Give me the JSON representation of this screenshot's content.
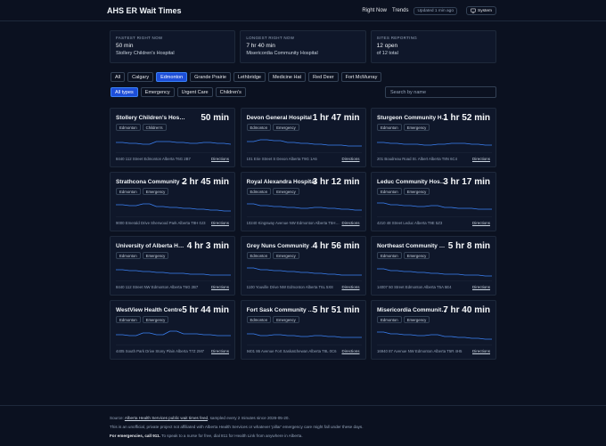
{
  "app": {
    "title": "AHS ER Wait Times"
  },
  "nav": {
    "right_now": "Right Now",
    "trends": "Trends",
    "updated": "Updated 1 min ago",
    "system": "System"
  },
  "stats": [
    {
      "label": "FASTEST RIGHT NOW",
      "value": "50 min",
      "sub": "Stollery Children's Hospital"
    },
    {
      "label": "LONGEST RIGHT NOW",
      "value": "7 hr 40 min",
      "sub": "Misericordia Community Hospital"
    },
    {
      "label": "SITES REPORTING",
      "value": "12 open",
      "sub": "of 12 total"
    }
  ],
  "cities": [
    "All",
    "Calgary",
    "Edmonton",
    "Grande Prairie",
    "Lethbridge",
    "Medicine Hat",
    "Red Deer",
    "Fort McMurray"
  ],
  "active_city": "Edmonton",
  "types": [
    "All types",
    "Emergency",
    "Urgent Care",
    "Children's"
  ],
  "active_type": "All types",
  "search": {
    "placeholder": "Search by name"
  },
  "directions_label": "Directions",
  "colors": {
    "accent": "#1d4ed8",
    "spark": "#3b82f6"
  },
  "hospitals": [
    {
      "name": "Stollery Children's Hospital",
      "wait": "50 min",
      "tags": [
        "Edmonton",
        "Children's"
      ],
      "address": "8440 112 Street Edmonton Alberta T6G 2B7",
      "trend": [
        0.55,
        0.55,
        0.5,
        0.5,
        0.45,
        0.45,
        0.6,
        0.6,
        0.6,
        0.55,
        0.55,
        0.5,
        0.5,
        0.55,
        0.55,
        0.5,
        0.5,
        0.45
      ]
    },
    {
      "name": "Devon General Hospital",
      "wait": "1 hr 47 min",
      "tags": [
        "Edmonton",
        "Emergency"
      ],
      "address": "101 Erie Street S Devon Alberta T9G 1A6",
      "trend": [
        0.6,
        0.6,
        0.7,
        0.7,
        0.65,
        0.65,
        0.55,
        0.55,
        0.5,
        0.5,
        0.45,
        0.45,
        0.4,
        0.4,
        0.4,
        0.35,
        0.35,
        0.35
      ]
    },
    {
      "name": "Sturgeon Community Hospital",
      "wait": "1 hr 52 min",
      "tags": [
        "Edmonton",
        "Emergency"
      ],
      "address": "201 Boudreau Road St. Albert Alberta T8N 6C4",
      "trend": [
        0.55,
        0.55,
        0.5,
        0.5,
        0.45,
        0.45,
        0.45,
        0.4,
        0.4,
        0.45,
        0.45,
        0.5,
        0.5,
        0.5,
        0.45,
        0.45,
        0.4,
        0.4
      ]
    },
    {
      "name": "Strathcona Community Hospital",
      "wait": "2 hr 45 min",
      "tags": [
        "Edmonton",
        "Emergency"
      ],
      "address": "9000 Emerald Drive Sherwood Park Alberta T8H 0J3",
      "trend": [
        0.65,
        0.65,
        0.6,
        0.6,
        0.7,
        0.7,
        0.55,
        0.55,
        0.5,
        0.5,
        0.45,
        0.45,
        0.4,
        0.4,
        0.35,
        0.35,
        0.3,
        0.3
      ]
    },
    {
      "name": "Royal Alexandra Hospital",
      "wait": "3 hr 12 min",
      "tags": [
        "Edmonton",
        "Emergency"
      ],
      "address": "10240 Kingsway Avenue NW Edmonton Alberta T5H 3V9",
      "trend": [
        0.7,
        0.7,
        0.6,
        0.6,
        0.55,
        0.55,
        0.5,
        0.5,
        0.45,
        0.45,
        0.5,
        0.5,
        0.45,
        0.45,
        0.4,
        0.4,
        0.35,
        0.35
      ]
    },
    {
      "name": "Leduc Community Hospital",
      "wait": "3 hr 17 min",
      "tags": [
        "Edmonton",
        "Emergency"
      ],
      "address": "4210 48 Street Leduc Alberta T9E 5Z3",
      "trend": [
        0.75,
        0.75,
        0.65,
        0.65,
        0.6,
        0.6,
        0.55,
        0.55,
        0.6,
        0.6,
        0.5,
        0.5,
        0.45,
        0.45,
        0.45,
        0.4,
        0.4,
        0.4
      ]
    },
    {
      "name": "University of Alberta Hospital",
      "wait": "4 hr 3 min",
      "tags": [
        "Edmonton",
        "Emergency"
      ],
      "address": "8440 112 Street NW Edmonton Alberta T6G 2B7",
      "trend": [
        0.6,
        0.6,
        0.55,
        0.55,
        0.5,
        0.5,
        0.45,
        0.45,
        0.4,
        0.4,
        0.4,
        0.35,
        0.35,
        0.35,
        0.3,
        0.3,
        0.3,
        0.3
      ]
    },
    {
      "name": "Grey Nuns Community Hospital",
      "wait": "4 hr 56 min",
      "tags": [
        "Edmonton",
        "Emergency"
      ],
      "address": "1100 Youville Drive NW Edmonton Alberta T6L 5X8",
      "trend": [
        0.7,
        0.7,
        0.6,
        0.6,
        0.55,
        0.55,
        0.5,
        0.5,
        0.45,
        0.45,
        0.4,
        0.4,
        0.35,
        0.35,
        0.3,
        0.3,
        0.3,
        0.3
      ]
    },
    {
      "name": "Northeast Community Health Centre",
      "wait": "5 hr 8 min",
      "tags": [
        "Edmonton",
        "Emergency"
      ],
      "address": "14007 50 Street Edmonton Alberta T5A 5E4",
      "trend": [
        0.65,
        0.65,
        0.55,
        0.55,
        0.5,
        0.5,
        0.45,
        0.45,
        0.4,
        0.4,
        0.35,
        0.35,
        0.35,
        0.3,
        0.3,
        0.3,
        0.25,
        0.25
      ]
    },
    {
      "name": "WestView Health Centre",
      "wait": "5 hr 44 min",
      "tags": [
        "Edmonton",
        "Emergency"
      ],
      "address": "4405 South Park Drive Stony Plain Alberta T7Z 2M7",
      "trend": [
        0.55,
        0.55,
        0.5,
        0.5,
        0.65,
        0.65,
        0.55,
        0.55,
        0.75,
        0.75,
        0.6,
        0.6,
        0.6,
        0.55,
        0.55,
        0.5,
        0.5,
        0.5
      ]
    },
    {
      "name": "Fort Sask Community Hospital",
      "wait": "5 hr 51 min",
      "tags": [
        "Edmonton",
        "Emergency"
      ],
      "address": "9401 86 Avenue Fort Saskatchewan Alberta T8L 0C6",
      "trend": [
        0.6,
        0.6,
        0.5,
        0.5,
        0.55,
        0.55,
        0.5,
        0.5,
        0.45,
        0.45,
        0.5,
        0.5,
        0.45,
        0.45,
        0.4,
        0.4,
        0.4,
        0.4
      ]
    },
    {
      "name": "Misericordia Community Hospital",
      "wait": "7 hr 40 min",
      "tags": [
        "Edmonton",
        "Emergency"
      ],
      "address": "16940 87 Avenue NW Edmonton Alberta T5R 4H5",
      "trend": [
        0.7,
        0.7,
        0.6,
        0.6,
        0.55,
        0.55,
        0.5,
        0.5,
        0.55,
        0.55,
        0.45,
        0.45,
        0.4,
        0.4,
        0.35,
        0.35,
        0.3,
        0.3
      ]
    }
  ],
  "footer": {
    "source_prefix": "Source: ",
    "source_link": "Alberta Health Services public wait times feed",
    "source_suffix": ", sampled every 2 minutes since 2026-05-20.",
    "disclaimer": "This is an unofficial, private project not affiliated with Alberta Health Services or whatever 'pillar' emergency care might fall under these days.",
    "emergency_bold": "For emergencies, call 911.",
    "emergency_rest": " To speak to a nurse for free, dial 811 for Health Link from anywhere in Alberta."
  }
}
